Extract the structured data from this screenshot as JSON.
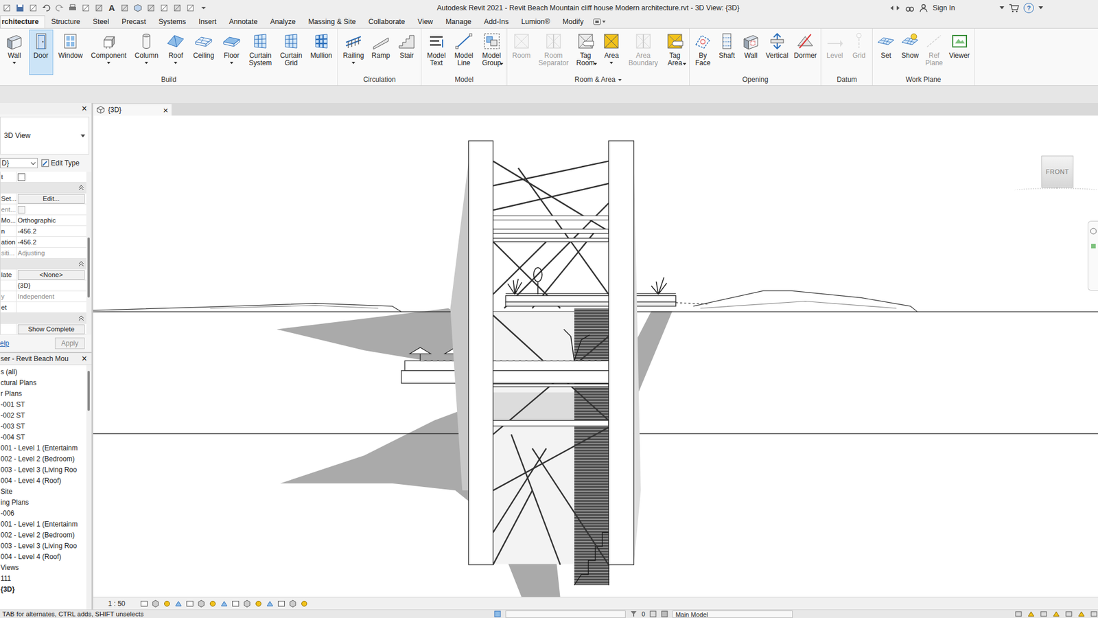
{
  "window": {
    "title": "Autodesk Revit 2021 - Revit Beach Mountain cliff house  Modern architecture.rvt - 3D View: {3D}",
    "text_tool": "A",
    "user": "Sign In",
    "help": "?"
  },
  "ribbon": {
    "tabs": [
      {
        "label": "rchitecture",
        "selected": true
      },
      {
        "label": "Structure",
        "selected": false
      },
      {
        "label": "Steel",
        "selected": false
      },
      {
        "label": "Precast",
        "selected": false
      },
      {
        "label": "Systems",
        "selected": false
      },
      {
        "label": "Insert",
        "selected": false
      },
      {
        "label": "Annotate",
        "selected": false
      },
      {
        "label": "Analyze",
        "selected": false
      },
      {
        "label": "Massing & Site",
        "selected": false
      },
      {
        "label": "Collaborate",
        "selected": false
      },
      {
        "label": "View",
        "selected": false
      },
      {
        "label": "Manage",
        "selected": false
      },
      {
        "label": "Add-Ins",
        "selected": false
      },
      {
        "label": "Lumion®",
        "selected": false
      },
      {
        "label": "Modify",
        "selected": false
      }
    ],
    "panels": [
      {
        "title": "Build",
        "expandable": false,
        "buttons": [
          {
            "label": "Wall",
            "selected": false,
            "disabled": false,
            "dropdown": true
          },
          {
            "label": "Door",
            "selected": true,
            "disabled": false,
            "dropdown": false
          },
          {
            "label": "Window",
            "selected": false,
            "disabled": false,
            "dropdown": false
          },
          {
            "label": "Component",
            "selected": false,
            "disabled": false,
            "dropdown": true
          },
          {
            "label": "Column",
            "selected": false,
            "disabled": false,
            "dropdown": true
          },
          {
            "label": "Roof",
            "selected": false,
            "disabled": false,
            "dropdown": true
          },
          {
            "label": "Ceiling",
            "selected": false,
            "disabled": false,
            "dropdown": false
          },
          {
            "label": "Floor",
            "selected": false,
            "disabled": false,
            "dropdown": true
          },
          {
            "label": "Curtain System",
            "selected": false,
            "disabled": false,
            "dropdown": false
          },
          {
            "label": "Curtain Grid",
            "selected": false,
            "disabled": false,
            "dropdown": false
          },
          {
            "label": "Mullion",
            "selected": false,
            "disabled": false,
            "dropdown": false
          }
        ]
      },
      {
        "title": "Circulation",
        "expandable": false,
        "buttons": [
          {
            "label": "Railing",
            "selected": false,
            "disabled": false,
            "dropdown": true
          },
          {
            "label": "Ramp",
            "selected": false,
            "disabled": false,
            "dropdown": false
          },
          {
            "label": "Stair",
            "selected": false,
            "disabled": false,
            "dropdown": false
          }
        ]
      },
      {
        "title": "Model",
        "expandable": false,
        "buttons": [
          {
            "label": "Model Text",
            "selected": false,
            "disabled": false,
            "dropdown": false
          },
          {
            "label": "Model Line",
            "selected": false,
            "disabled": false,
            "dropdown": false
          },
          {
            "label": "Model Group",
            "selected": false,
            "disabled": false,
            "dropdown": true
          }
        ]
      },
      {
        "title": "Room & Area",
        "expandable": true,
        "buttons": [
          {
            "label": "Room",
            "selected": false,
            "disabled": true,
            "dropdown": false
          },
          {
            "label": "Room Separator",
            "selected": false,
            "disabled": true,
            "dropdown": false
          },
          {
            "label": "Tag Room",
            "selected": false,
            "disabled": false,
            "dropdown": true
          },
          {
            "label": "Area",
            "selected": false,
            "disabled": false,
            "dropdown": true
          },
          {
            "label": "Area Boundary",
            "selected": false,
            "disabled": true,
            "dropdown": false
          },
          {
            "label": "Tag Area",
            "selected": false,
            "disabled": false,
            "dropdown": true
          }
        ]
      },
      {
        "title": "Opening",
        "expandable": false,
        "buttons": [
          {
            "label": "By Face",
            "selected": false,
            "disabled": false,
            "dropdown": false
          },
          {
            "label": "Shaft",
            "selected": false,
            "disabled": false,
            "dropdown": false
          },
          {
            "label": "Wall",
            "selected": false,
            "disabled": false,
            "dropdown": false
          },
          {
            "label": "Vertical",
            "selected": false,
            "disabled": false,
            "dropdown": false
          },
          {
            "label": "Dormer",
            "selected": false,
            "disabled": false,
            "dropdown": false
          }
        ]
      },
      {
        "title": "Datum",
        "expandable": false,
        "buttons": [
          {
            "label": "Level",
            "selected": false,
            "disabled": true,
            "dropdown": false
          },
          {
            "label": "Grid",
            "selected": false,
            "disabled": true,
            "dropdown": false
          }
        ]
      },
      {
        "title": "Work Plane",
        "expandable": false,
        "buttons": [
          {
            "label": "Set",
            "selected": false,
            "disabled": false,
            "dropdown": false
          },
          {
            "label": "Show",
            "selected": false,
            "disabled": false,
            "dropdown": false
          },
          {
            "label": "Ref Plane",
            "selected": false,
            "disabled": true,
            "dropdown": false
          },
          {
            "label": "Viewer",
            "selected": false,
            "disabled": false,
            "dropdown": false
          }
        ]
      }
    ]
  },
  "properties": {
    "close": "×",
    "type": "3D View",
    "view_selector": "D}",
    "edit_type": "Edit Type",
    "rows": [
      {
        "kind": "checkbox",
        "label": "t",
        "checked": false,
        "disabled": false
      },
      {
        "kind": "header",
        "label": "",
        "expanded": true
      },
      {
        "kind": "button",
        "label": "Set...",
        "value": "Edit...",
        "disabled": false
      },
      {
        "kind": "checkbox",
        "label": "ent...",
        "checked": false,
        "disabled": true
      },
      {
        "kind": "text",
        "label": "Mo...",
        "value": "Orthographic",
        "disabled": false
      },
      {
        "kind": "text",
        "label": "n",
        "value": "-456.2",
        "disabled": false
      },
      {
        "kind": "text",
        "label": "ation",
        "value": "-456.2",
        "disabled": false
      },
      {
        "kind": "text",
        "label": "siti...",
        "value": "Adjusting",
        "disabled": true
      },
      {
        "kind": "header",
        "label": "",
        "expanded": true
      },
      {
        "kind": "button",
        "label": "late",
        "value": "<None>",
        "disabled": false
      },
      {
        "kind": "text",
        "label": "",
        "value": "{3D}",
        "disabled": false
      },
      {
        "kind": "text",
        "label": "y",
        "value": "Independent",
        "disabled": true
      },
      {
        "kind": "text",
        "label": "et",
        "value": "",
        "disabled": false
      },
      {
        "kind": "header",
        "label": "",
        "expanded": true
      },
      {
        "kind": "button",
        "label": "",
        "value": "Show Complete",
        "disabled": false
      }
    ],
    "help": "elp",
    "apply": "Apply",
    "apply_disabled": true
  },
  "project_browser": {
    "title": "ser - Revit Beach Mou",
    "close": "×",
    "items": [
      {
        "label": "s (all)",
        "selected": false
      },
      {
        "label": "ctural Plans",
        "selected": false
      },
      {
        "label": "r Plans",
        "selected": false
      },
      {
        "label": "-001 ST",
        "selected": false
      },
      {
        "label": "-002 ST",
        "selected": false
      },
      {
        "label": "-003 ST",
        "selected": false
      },
      {
        "label": "-004 ST",
        "selected": false
      },
      {
        "label": "001 - Level 1 (Entertainm",
        "selected": false
      },
      {
        "label": "002 - Level 2 (Bedroom)",
        "selected": false
      },
      {
        "label": "003 - Level 3 (Living Roo",
        "selected": false
      },
      {
        "label": "004 - Level 4 (Roof)",
        "selected": false
      },
      {
        "label": "Site",
        "selected": false
      },
      {
        "label": "ing Plans",
        "selected": false
      },
      {
        "label": "-006",
        "selected": false
      },
      {
        "label": "001 - Level 1 (Entertainm",
        "selected": false
      },
      {
        "label": "002 - Level 2 (Bedroom)",
        "selected": false
      },
      {
        "label": "003 - Level 3 (Living Roo",
        "selected": false
      },
      {
        "label": "004 - Level 4 (Roof)",
        "selected": false
      },
      {
        "label": "Views",
        "selected": false
      },
      {
        "label": "111",
        "selected": false
      },
      {
        "label": "{3D}",
        "selected": true
      }
    ]
  },
  "view_tab": {
    "label": "{3D}",
    "close": "×"
  },
  "view_cube": {
    "face": "FRONT"
  },
  "view_control": {
    "scale": "1 : 50"
  },
  "status_bar": {
    "hint": "TAB for alternates, CTRL adds, SHIFT unselects",
    "selection_count": "0",
    "model": "Main Model"
  }
}
